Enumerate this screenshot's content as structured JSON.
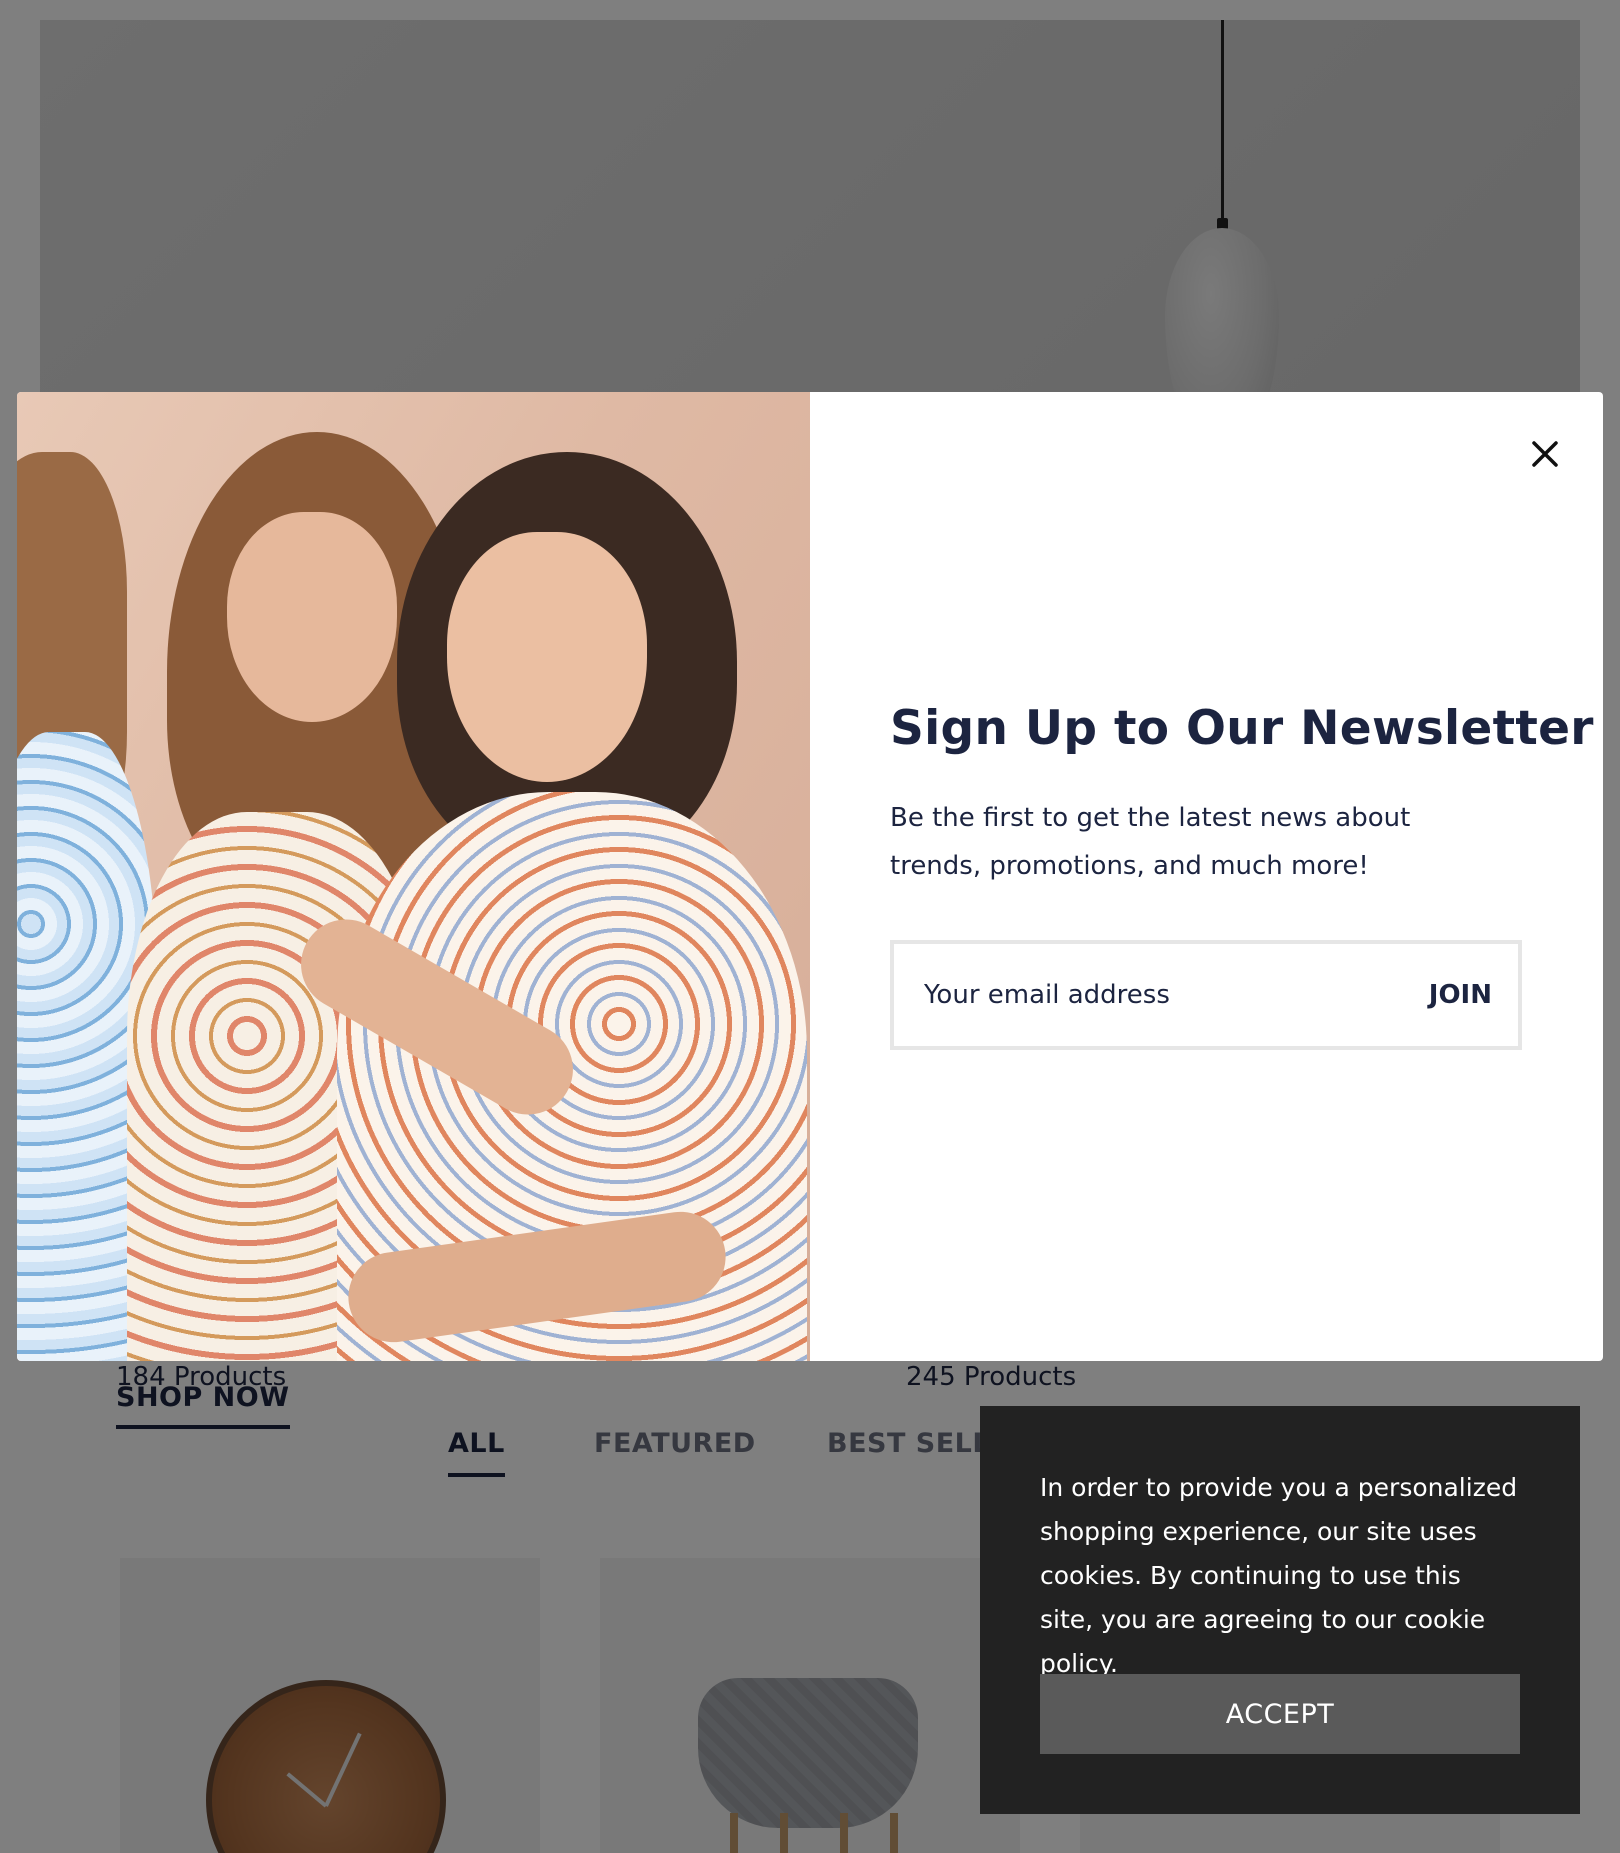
{
  "categories": {
    "first_count": "184 Products",
    "second_count": "245 Products",
    "shop_now": "SHOP NOW"
  },
  "product_tabs": [
    "ALL",
    "FEATURED",
    "BEST SELLER"
  ],
  "newsletter": {
    "title": "Sign Up to Our Newsletter",
    "text": "Be the first to get the latest news about trends, promotions, and much more!",
    "email_placeholder": "Your email address",
    "join_label": "JOIN",
    "close_icon": "close-icon"
  },
  "cookie": {
    "text": "In order to provide you a personalized shopping experience, our site uses cookies. By continuing to use this site, you are agreeing to our cookie policy.",
    "accept_label": "ACCEPT"
  },
  "colors": {
    "text_navy": "#1c2440",
    "cookie_bg": "#222222",
    "accept_bg": "#5a5a5a"
  }
}
